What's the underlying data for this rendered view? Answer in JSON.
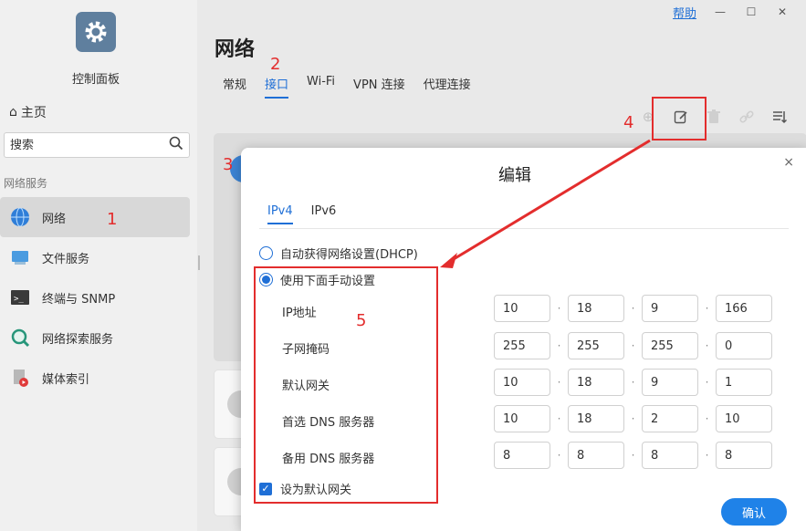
{
  "window": {
    "help_label": "帮助",
    "minimize": "—",
    "maximize": "☐",
    "close": "✕"
  },
  "sidebar": {
    "app_name": "控制面板",
    "home_label": "主页",
    "search_placeholder": "搜索",
    "section_title": "网络服务",
    "items": [
      {
        "label": "网络",
        "icon": "globe-icon"
      },
      {
        "label": "文件服务",
        "icon": "file-services-icon"
      },
      {
        "label": "终端与 SNMP",
        "icon": "terminal-icon"
      },
      {
        "label": "网络探索服务",
        "icon": "magnifier-icon"
      },
      {
        "label": "媒体索引",
        "icon": "media-index-icon"
      }
    ]
  },
  "main": {
    "title": "网络",
    "tabs": [
      "常规",
      "接口",
      "Wi-Fi",
      "VPN 连接",
      "代理连接"
    ],
    "active_tab": "接口"
  },
  "toolbar": {
    "icons": [
      "add-icon",
      "edit-icon",
      "delete-icon",
      "link-icon",
      "sort-icon"
    ]
  },
  "annotations": [
    "1",
    "2",
    "3",
    "4",
    "5"
  ],
  "modal": {
    "title": "编辑",
    "close": "×",
    "tabs": [
      "IPv4",
      "IPv6"
    ],
    "dhcp_label": "自动获得网络设置(DHCP)",
    "manual_label": "使用下面手动设置",
    "fields": [
      {
        "label": "IP地址",
        "values": [
          "10",
          "18",
          "9",
          "166"
        ]
      },
      {
        "label": "子网掩码",
        "values": [
          "255",
          "255",
          "255",
          "0"
        ]
      },
      {
        "label": "默认网关",
        "values": [
          "10",
          "18",
          "9",
          "1"
        ]
      },
      {
        "label": "首选 DNS 服务器",
        "values": [
          "10",
          "18",
          "2",
          "10"
        ]
      },
      {
        "label": "备用 DNS 服务器",
        "values": [
          "8",
          "8",
          "8",
          "8"
        ]
      }
    ],
    "default_gateway_label": "设为默认网关",
    "confirm_label": "确认"
  },
  "colors": {
    "accent": "#1f6fd6",
    "annotation": "#e32d2d",
    "confirm": "#1f82e8"
  }
}
